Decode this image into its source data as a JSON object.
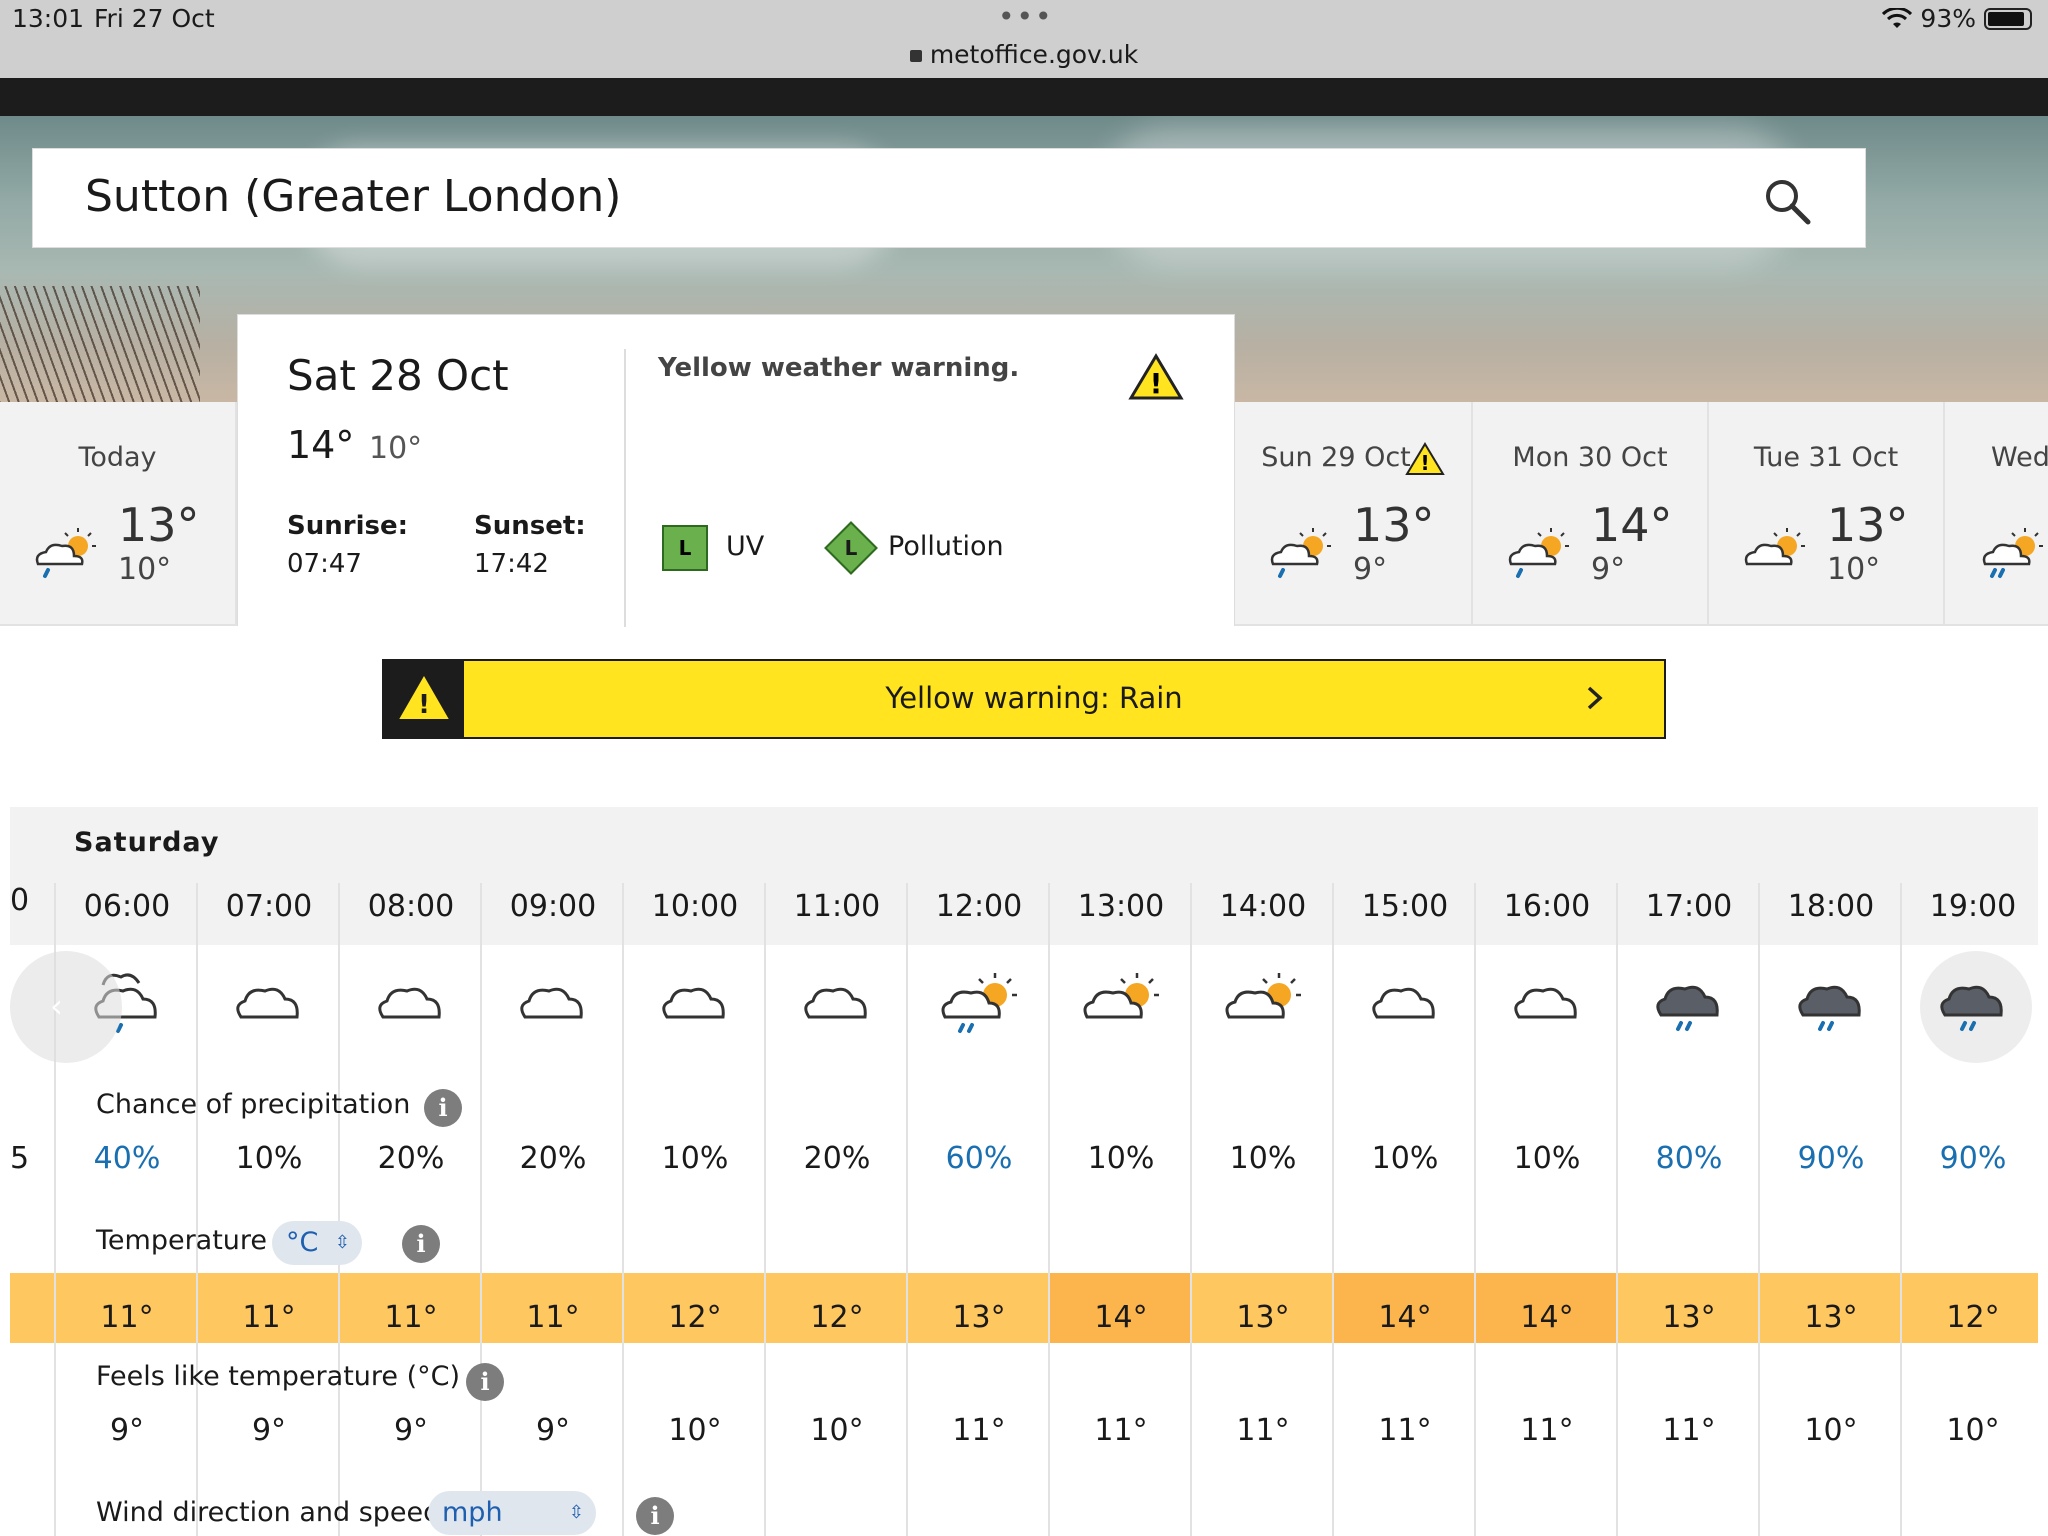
{
  "status": {
    "time": "13:01",
    "date": "Fri 27 Oct",
    "battery": "93%",
    "url": "metoffice.gov.uk"
  },
  "search": {
    "location": "Sutton (Greater London)"
  },
  "days": [
    {
      "name": "Today",
      "hi": "13°",
      "lo": "10°",
      "icon": "sun-cloud-drizzle-icon",
      "warning": false
    },
    {
      "name": "Sun 29 Oct",
      "hi": "13°",
      "lo": "9°",
      "icon": "sun-cloud-drizzle-icon",
      "warning": true
    },
    {
      "name": "Mon 30 Oct",
      "hi": "14°",
      "lo": "9°",
      "icon": "sun-cloud-drizzle-icon",
      "warning": false
    },
    {
      "name": "Tue 31 Oct",
      "hi": "13°",
      "lo": "10°",
      "icon": "sun-cloud-icon",
      "warning": false
    },
    {
      "name": "Wed",
      "icon": "sun-cloud-rain-icon",
      "warning": false
    }
  ],
  "selected_day": {
    "date": "Sat 28 Oct",
    "hi": "14°",
    "lo": "10°",
    "sunrise_label": "Sunrise:",
    "sunrise": "07:47",
    "sunset_label": "Sunset:",
    "sunset": "17:42",
    "warning_text": "Yellow weather warning.",
    "uv_level": "L",
    "uv_label": "UV",
    "pollution_level": "L",
    "pollution_label": "Pollution"
  },
  "banner": {
    "text": "Yellow warning: Rain"
  },
  "hourly": {
    "day_label": "Saturday",
    "partial_time": "0",
    "partial_pct": "5",
    "precip_label": "Chance of precipitation",
    "temp_label": "Temperature",
    "temp_unit": "°C",
    "feels_label": "Feels like temperature (°C)",
    "wind_label": "Wind direction and speed",
    "wind_unit": "mph",
    "info_glyph": "i",
    "hours": [
      {
        "time": "06:00",
        "icon": "partly-cloudy-night-drizzle-icon",
        "pct": "40%",
        "pct_high": true,
        "temp": "11°",
        "feels": "9°"
      },
      {
        "time": "07:00",
        "icon": "cloud-icon",
        "pct": "10%",
        "pct_high": false,
        "temp": "11°",
        "feels": "9°"
      },
      {
        "time": "08:00",
        "icon": "cloud-icon",
        "pct": "20%",
        "pct_high": false,
        "temp": "11°",
        "feels": "9°"
      },
      {
        "time": "09:00",
        "icon": "cloud-icon",
        "pct": "20%",
        "pct_high": false,
        "temp": "11°",
        "feels": "9°"
      },
      {
        "time": "10:00",
        "icon": "cloud-icon",
        "pct": "10%",
        "pct_high": false,
        "temp": "12°",
        "feels": "10°"
      },
      {
        "time": "11:00",
        "icon": "cloud-icon",
        "pct": "20%",
        "pct_high": false,
        "temp": "12°",
        "feels": "10°"
      },
      {
        "time": "12:00",
        "icon": "sun-cloud-drizzle-icon",
        "pct": "60%",
        "pct_high": true,
        "temp": "13°",
        "feels": "11°"
      },
      {
        "time": "13:00",
        "icon": "sun-cloud-icon",
        "pct": "10%",
        "pct_high": false,
        "temp": "14°",
        "feels": "11°"
      },
      {
        "time": "14:00",
        "icon": "sun-cloud-icon",
        "pct": "10%",
        "pct_high": false,
        "temp": "13°",
        "feels": "11°"
      },
      {
        "time": "15:00",
        "icon": "cloud-icon",
        "pct": "10%",
        "pct_high": false,
        "temp": "14°",
        "feels": "11°"
      },
      {
        "time": "16:00",
        "icon": "cloud-icon",
        "pct": "10%",
        "pct_high": false,
        "temp": "14°",
        "feels": "11°"
      },
      {
        "time": "17:00",
        "icon": "dark-cloud-rain-icon",
        "pct": "80%",
        "pct_high": true,
        "temp": "13°",
        "feels": "11°"
      },
      {
        "time": "18:00",
        "icon": "dark-cloud-rain-icon",
        "pct": "90%",
        "pct_high": true,
        "temp": "13°",
        "feels": "10°"
      },
      {
        "time": "19:00",
        "icon": "dark-cloud-rain-icon",
        "pct": "90%",
        "pct_high": true,
        "temp": "12°",
        "feels": "10°"
      }
    ]
  },
  "colors": {
    "temp_band": "#ffc75f",
    "warning_yellow": "#ffe41f",
    "high_precip_blue": "#1a6fb0",
    "uv_green": "#6ab04c"
  }
}
